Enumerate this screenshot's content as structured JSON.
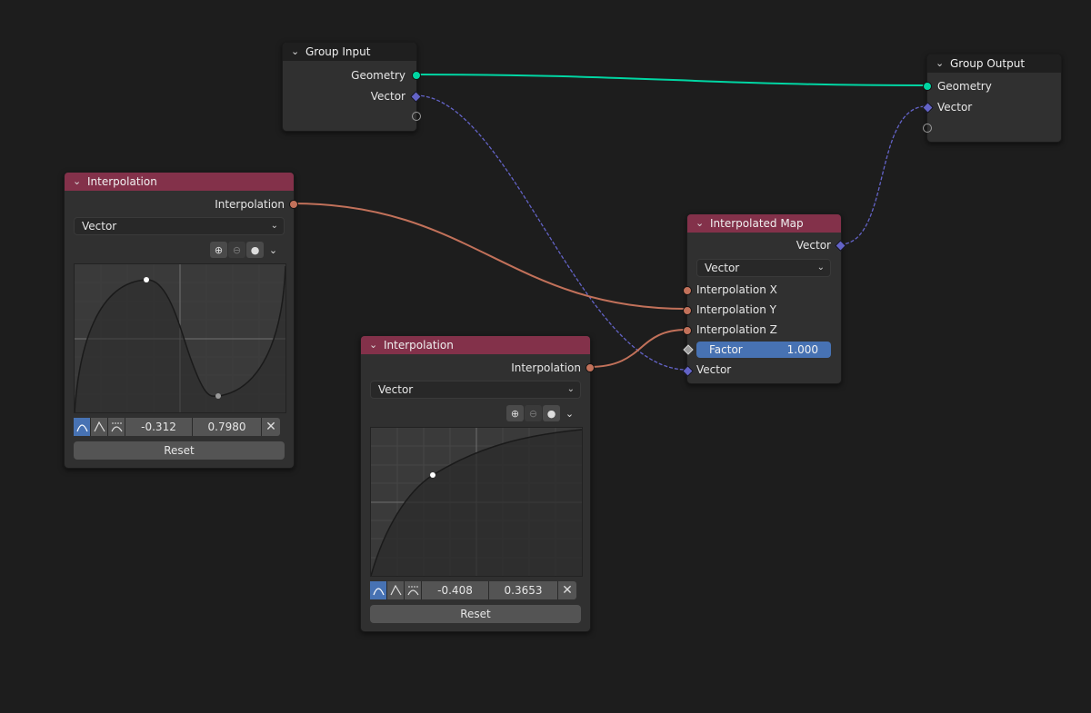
{
  "colors": {
    "background": "#1d1d1d",
    "node_body": "#303030",
    "header_dark": "#1f1f1f",
    "header_red": "#83314a",
    "geometry_socket": "#00d6a3",
    "interpolation_socket": "#c2715a",
    "vector_socket": "#6363c7",
    "factor_field": "#4772b3",
    "active_button": "#4772b3"
  },
  "group_input": {
    "title": "Group Input",
    "outputs": [
      "Geometry",
      "Vector"
    ]
  },
  "group_output": {
    "title": "Group Output",
    "inputs": [
      "Geometry",
      "Vector"
    ]
  },
  "interp_node_1": {
    "title": "Interpolation",
    "output": "Interpolation",
    "mode": "Vector",
    "point_x": "-0.312",
    "point_y": "0.7980",
    "reset_label": "Reset",
    "toolbar_icons": [
      "zoom-in-icon",
      "zoom-out-icon",
      "dot-icon",
      "chevron-down-icon"
    ],
    "handle_icons": [
      "auto-handle-icon",
      "vector-handle-icon",
      "auto-clamped-handle-icon",
      "close-icon"
    ]
  },
  "interp_node_2": {
    "title": "Interpolation",
    "output": "Interpolation",
    "mode": "Vector",
    "point_x": "-0.408",
    "point_y": "0.3653",
    "reset_label": "Reset",
    "toolbar_icons": [
      "zoom-in-icon",
      "zoom-out-icon",
      "dot-icon",
      "chevron-down-icon"
    ],
    "handle_icons": [
      "auto-handle-icon",
      "vector-handle-icon",
      "auto-clamped-handle-icon",
      "close-icon"
    ]
  },
  "interpolated_map": {
    "title": "Interpolated Map",
    "output": "Vector",
    "mode": "Vector",
    "inputs": [
      "Interpolation X",
      "Interpolation Y",
      "Interpolation Z"
    ],
    "factor_label": "Factor",
    "factor_value": "1.000",
    "vector_input": "Vector"
  }
}
